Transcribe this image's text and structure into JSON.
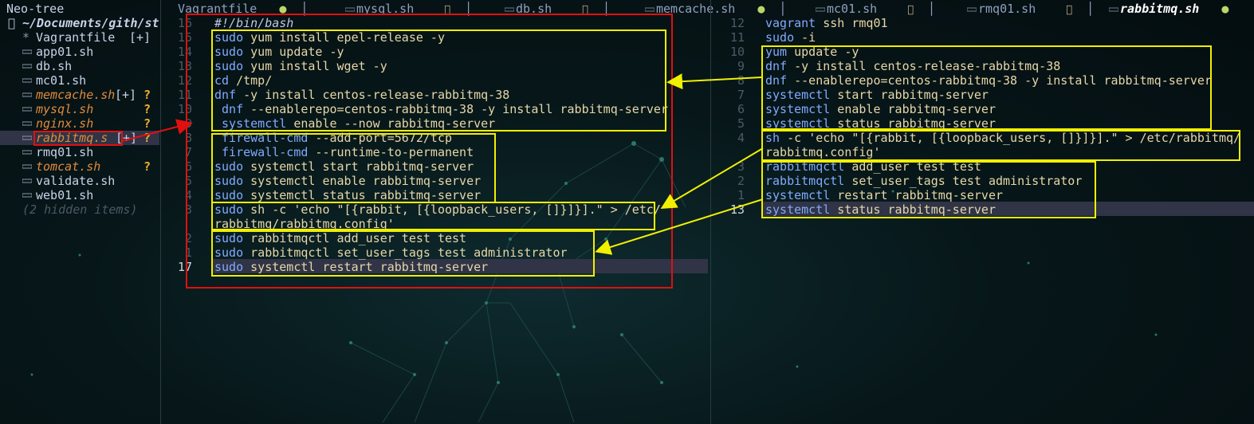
{
  "sidebar": {
    "title": "Neo-tree",
    "root_icon": "folder-open-icon",
    "root_glyph": "󰝰",
    "root_path": "~/Documents/gith/st",
    "items": [
      {
        "name": "Vagrantfile",
        "marker": "[+]",
        "status": "",
        "style": "normal",
        "glyph": "*"
      },
      {
        "name": "app01.sh",
        "marker": "",
        "status": "",
        "style": "normal",
        "glyph": ""
      },
      {
        "name": "db.sh",
        "marker": "",
        "status": "",
        "style": "normal",
        "glyph": ""
      },
      {
        "name": "mc01.sh",
        "marker": "",
        "status": "",
        "style": "normal",
        "glyph": ""
      },
      {
        "name": "memcache.sh",
        "marker": "[+]",
        "status": "?",
        "style": "modified",
        "glyph": ""
      },
      {
        "name": "mysql.sh",
        "marker": "",
        "status": "?",
        "style": "modified",
        "glyph": ""
      },
      {
        "name": "nginx.sh",
        "marker": "",
        "status": "?",
        "style": "modified",
        "glyph": ""
      },
      {
        "name": "rabbitmq.s",
        "marker": "[+]",
        "status": "?",
        "style": "modified",
        "glyph": ""
      },
      {
        "name": "rmq01.sh",
        "marker": "",
        "status": "",
        "style": "normal",
        "glyph": ""
      },
      {
        "name": "tomcat.sh",
        "marker": "",
        "status": "?",
        "style": "modified",
        "glyph": ""
      },
      {
        "name": "validate.sh",
        "marker": "",
        "status": "",
        "style": "normal",
        "glyph": ""
      },
      {
        "name": "web01.sh",
        "marker": "",
        "status": "",
        "style": "normal",
        "glyph": ""
      },
      {
        "name": "(2 hidden items)",
        "marker": "",
        "status": "",
        "style": "dim",
        "glyph": ""
      }
    ]
  },
  "tabs": [
    {
      "label": "Vagrantfile",
      "indicator": "●",
      "indicator_type": "dot",
      "active": false
    },
    {
      "label": "mysql.sh",
      "indicator": "󰩈",
      "indicator_type": "sym",
      "active": false
    },
    {
      "label": "db.sh",
      "indicator": "󰩈",
      "indicator_type": "sym",
      "active": false
    },
    {
      "label": "memcache.sh",
      "indicator": "●",
      "indicator_type": "dot",
      "active": false
    },
    {
      "label": "mc01.sh",
      "indicator": "󰩈",
      "indicator_type": "sym",
      "active": false
    },
    {
      "label": "rmq01.sh",
      "indicator": "󰩈",
      "indicator_type": "sym",
      "active": false
    },
    {
      "label": "rabbitmq.sh",
      "indicator": "●",
      "indicator_type": "dot",
      "active": true
    }
  ],
  "left_editor": {
    "lines": [
      {
        "num": "16",
        "text": "#!/bin/bash"
      },
      {
        "num": "15",
        "text": "sudo yum install epel-release -y"
      },
      {
        "num": "14",
        "text": "sudo yum update -y"
      },
      {
        "num": "13",
        "text": "sudo yum install wget -y"
      },
      {
        "num": "12",
        "text": "cd /tmp/"
      },
      {
        "num": "11",
        "text": "dnf -y install centos-release-rabbitmq-38"
      },
      {
        "num": "10",
        "text": " dnf --enablerepo=centos-rabbitmq-38 -y install rabbitmq-server"
      },
      {
        "num": "9",
        "text": " systemctl enable --now rabbitmq-server"
      },
      {
        "num": "8",
        "text": " firewall-cmd --add-port=5672/tcp"
      },
      {
        "num": "7",
        "text": " firewall-cmd --runtime-to-permanent"
      },
      {
        "num": "6",
        "text": "sudo systemctl start rabbitmq-server"
      },
      {
        "num": "5",
        "text": "sudo systemctl enable rabbitmq-server"
      },
      {
        "num": "4",
        "text": "sudo systemctl status rabbitmq-server"
      },
      {
        "num": "3",
        "text": "sudo sh -c 'echo \"[{rabbit, [{loopback_users, []}]}].\" > /etc/"
      },
      {
        "num": "",
        "text": "rabbitmq/rabbitmq.config'"
      },
      {
        "num": "2",
        "text": "sudo rabbitmqctl add_user test test"
      },
      {
        "num": "1",
        "text": "sudo rabbitmqctl set_user_tags test administrator"
      },
      {
        "num": "17",
        "text": "sudo systemctl restart rabbitmq-server"
      }
    ]
  },
  "right_editor": {
    "lines": [
      {
        "num": "12",
        "text": "vagrant ssh rmq01"
      },
      {
        "num": "11",
        "text": "sudo -i"
      },
      {
        "num": "10",
        "text": "yum update -y"
      },
      {
        "num": "9",
        "text": "dnf -y install centos-release-rabbitmq-38"
      },
      {
        "num": "8",
        "text": "dnf --enablerepo=centos-rabbitmq-38 -y install rabbitmq-server"
      },
      {
        "num": "7",
        "text": "systemctl start rabbitmq-server"
      },
      {
        "num": "6",
        "text": "systemctl enable rabbitmq-server"
      },
      {
        "num": "5",
        "text": "systemctl status rabbitmq-server"
      },
      {
        "num": "4",
        "text": "sh -c 'echo \"[{rabbit, [{loopback_users, []}]}].\" > /etc/rabbitmq/"
      },
      {
        "num": "",
        "text": "rabbitmq.config'"
      },
      {
        "num": "3",
        "text": "rabbitmqctl add_user test test"
      },
      {
        "num": "2",
        "text": "rabbitmqctl set_user_tags test administrator"
      },
      {
        "num": "1",
        "text": "systemctl restart rabbitmq-server"
      },
      {
        "num": "13",
        "text": "systemctl status rabbitmq-server"
      }
    ]
  },
  "colors": {
    "annotation_box": "#f0f000",
    "focus_box": "#e01010",
    "modified_file": "#e08a3c",
    "untracked_marker": "#f0b030",
    "cursor_line": "#303446"
  }
}
